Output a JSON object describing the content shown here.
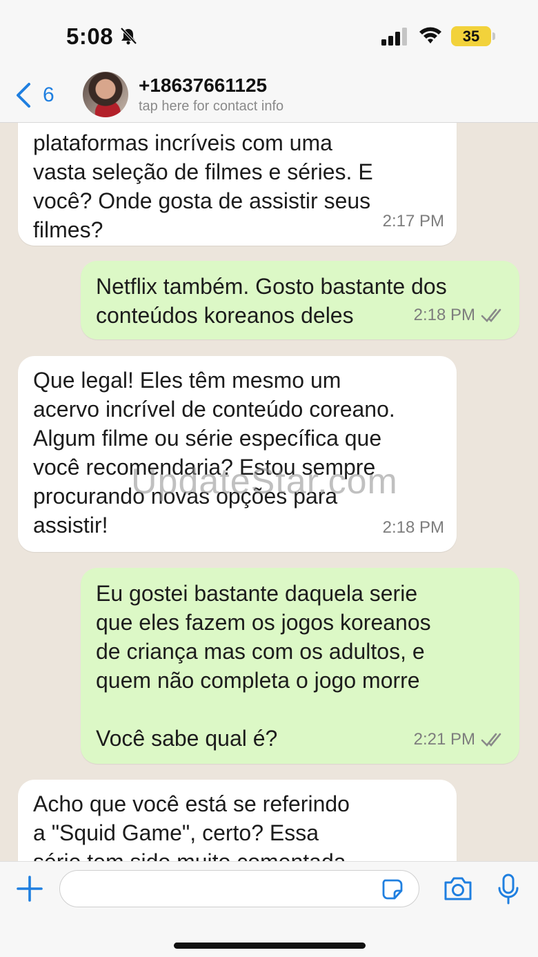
{
  "status_bar": {
    "time": "5:08",
    "battery": "35",
    "icons": [
      "bell-slash-icon",
      "signal-icon",
      "wifi-icon",
      "battery-icon"
    ]
  },
  "header": {
    "back_count": "6",
    "contact_name": "+18637661125",
    "contact_subtitle": "tap here for contact info",
    "accent_color": "#1f7fe0"
  },
  "messages": [
    {
      "direction": "incoming",
      "text": "plataformas incríveis com uma\nvasta seleção de filmes e séries. E\nvocê? Onde gosta de assistir seus\nfilmes?",
      "time": "2:17 PM"
    },
    {
      "direction": "outgoing",
      "text": "Netflix também. Gosto bastante dos\nconteúdos koreanos deles",
      "time": "2:18 PM",
      "status": "read-ticks"
    },
    {
      "direction": "incoming",
      "text": "Que legal! Eles têm mesmo um\nacervo incrível de conteúdo coreano.\nAlgum filme ou série específica que\nvocê recomendaria? Estou sempre\nprocurando novas opções para\nassistir!",
      "time": "2:18 PM"
    },
    {
      "direction": "outgoing",
      "text": "Eu gostei bastante daquela serie\nque eles fazem os jogos koreanos\nde criança mas com os adultos, e\nquem não completa o jogo morre\n\nVocê sabe qual é?",
      "time": "2:21 PM",
      "status": "read-ticks"
    },
    {
      "direction": "incoming",
      "text": "Acho que você está se referindo\na \"Squid Game\", certo? Essa\nsérie tem sido muito comentada",
      "time": ""
    }
  ],
  "watermark": "UpdateStar.com",
  "input_bar": {
    "placeholder": "",
    "icons": [
      "plus-icon",
      "sticker-icon",
      "camera-icon",
      "microphone-icon"
    ]
  },
  "colors": {
    "incoming_bubble": "#ffffff",
    "outgoing_bubble": "#dcf8c6",
    "chat_background": "#ece5dc"
  }
}
